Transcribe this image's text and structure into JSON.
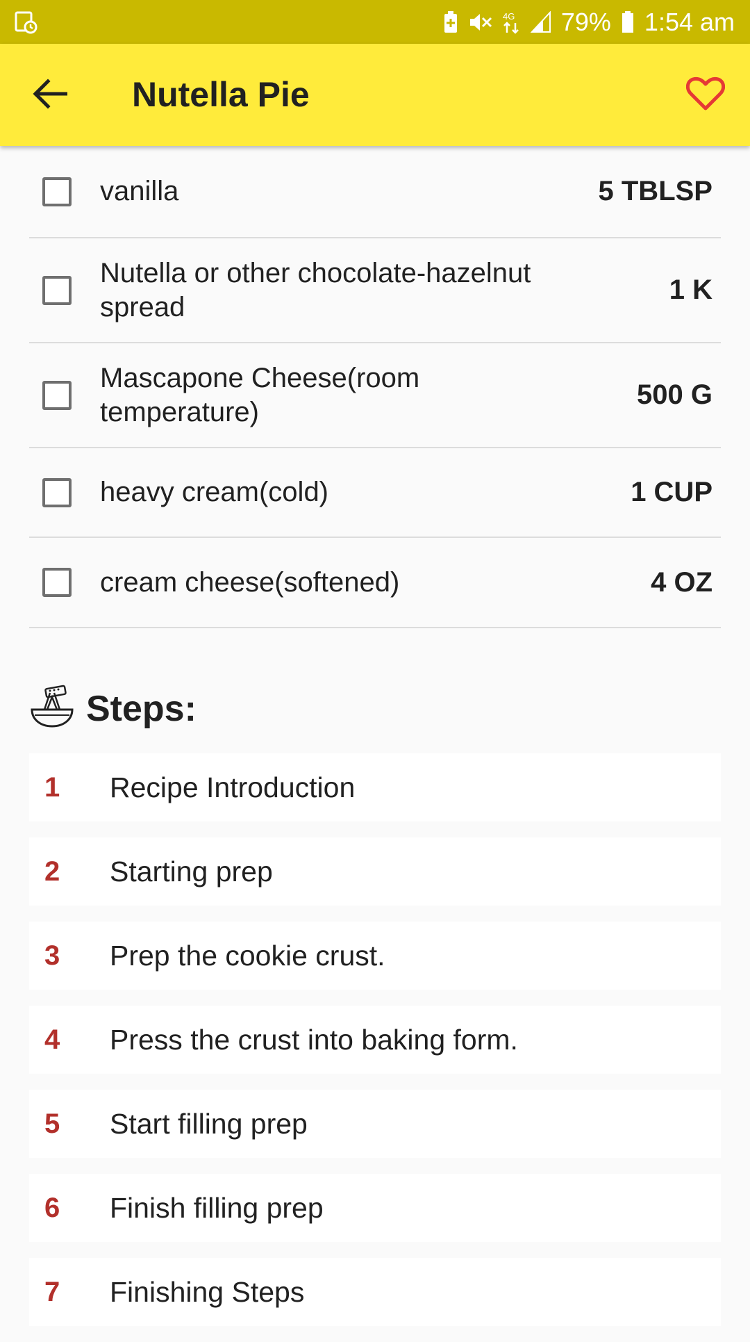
{
  "status_bar": {
    "battery_percent": "79%",
    "time": "1:54 am",
    "network": "4G",
    "icons": [
      "screen-recorder-icon",
      "battery-saver-icon",
      "mute-icon",
      "mobile-data-icon",
      "signal-icon",
      "battery-icon"
    ]
  },
  "app_bar": {
    "title": "Nutella Pie",
    "back_icon": "arrow-back-icon",
    "favorite_icon": "heart-outline-icon",
    "accent_color": "#ffeb3b",
    "favorite_color": "#e53935"
  },
  "ingredients": [
    {
      "name": "vanilla",
      "quantity": "5 TBLSP",
      "checked": false
    },
    {
      "name": "Nutella or other chocolate-hazelnut spread",
      "quantity": "1 K",
      "checked": false
    },
    {
      "name": "Mascapone Cheese(room temperature)",
      "quantity": "500 G",
      "checked": false
    },
    {
      "name": "heavy cream(cold)",
      "quantity": "1 CUP",
      "checked": false
    },
    {
      "name": "cream cheese(softened)",
      "quantity": "4 OZ",
      "checked": false
    }
  ],
  "steps_section": {
    "title": "Steps:",
    "icon": "mixing-bowl-icon",
    "number_color": "#b2302b",
    "items": [
      {
        "number": "1",
        "text": "Recipe Introduction"
      },
      {
        "number": "2",
        "text": "Starting prep"
      },
      {
        "number": "3",
        "text": "Prep the cookie crust."
      },
      {
        "number": "4",
        "text": "Press the crust into baking form."
      },
      {
        "number": "5",
        "text": "Start filling prep"
      },
      {
        "number": "6",
        "text": "Finish filling prep"
      },
      {
        "number": "7",
        "text": "Finishing Steps"
      }
    ]
  }
}
